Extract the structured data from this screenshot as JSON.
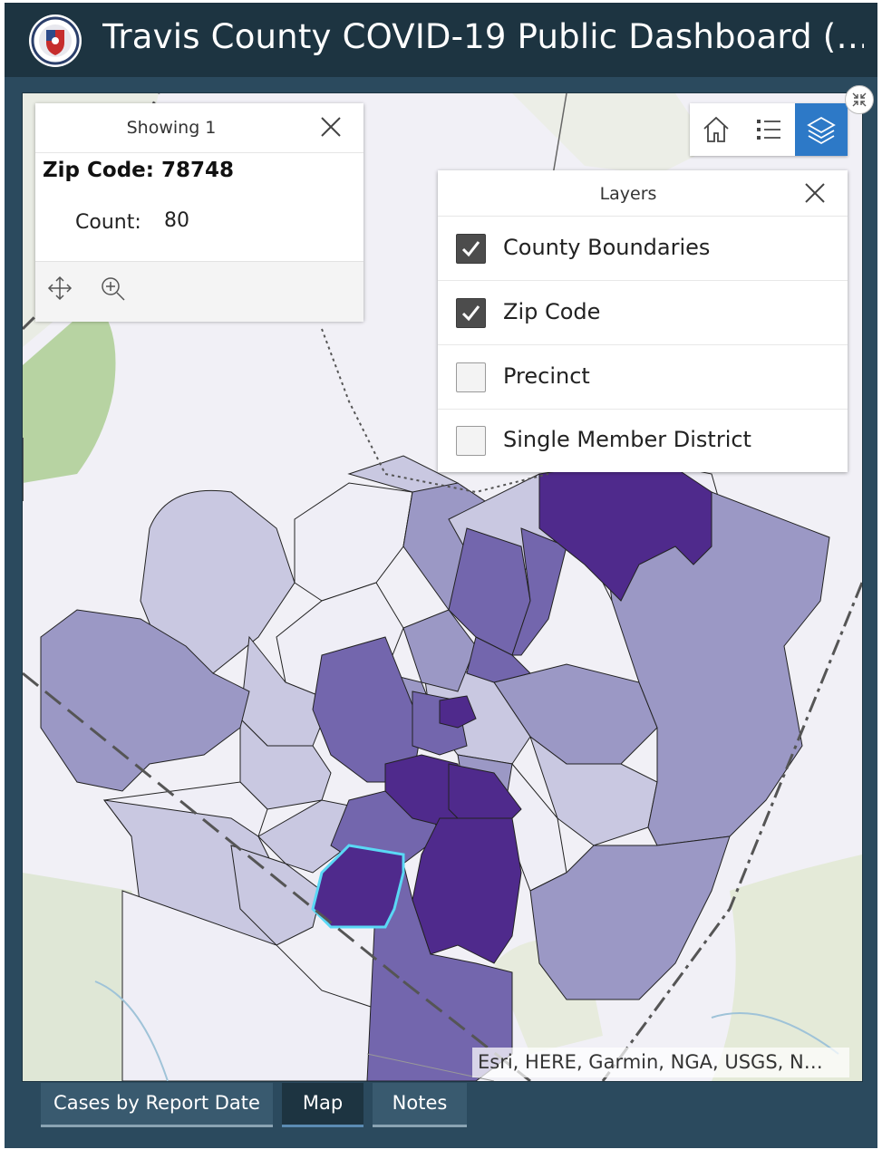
{
  "header": {
    "title": "Travis County COVID-19 Public Dashboard (…",
    "logo_icon": "city-of-austin-seal-icon"
  },
  "popup": {
    "heading": "Showing 1",
    "title": "Zip Code: 78748",
    "count_label": "Count:",
    "count_value": "80",
    "close_icon": "close-icon",
    "pan_icon": "pan-icon",
    "zoom_icon": "zoom-in-icon"
  },
  "toolbar": {
    "home_icon": "home-icon",
    "legend_icon": "legend-list-icon",
    "layers_icon": "layers-icon"
  },
  "layers_panel": {
    "heading": "Layers",
    "items": [
      {
        "label": "County Boundaries",
        "checked": true
      },
      {
        "label": "Zip Code",
        "checked": true
      },
      {
        "label": "Precinct",
        "checked": false
      },
      {
        "label": "Single Member District",
        "checked": false
      }
    ]
  },
  "map": {
    "attribution": "Esri, HERE, Garmin, NGA, USGS, N…",
    "selected_zip": "78748",
    "colors": {
      "darkest": "#4f2a8c",
      "dark": "#7366ad",
      "medium": "#9b98c5",
      "light": "#c9c8e1",
      "lightest": "#efeef6",
      "highlight": "#5ad8f5"
    }
  },
  "tabs": [
    {
      "label": "Cases by Report Date",
      "active": false
    },
    {
      "label": "Map",
      "active": true
    },
    {
      "label": "Notes",
      "active": false
    }
  ]
}
